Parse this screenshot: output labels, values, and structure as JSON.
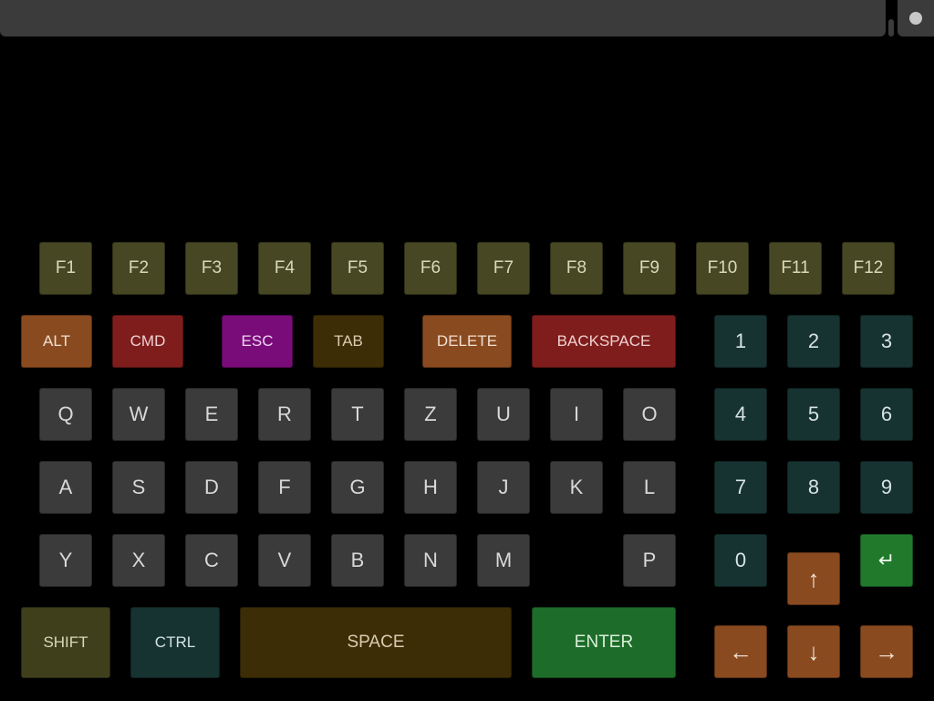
{
  "top_bar": {
    "input_value": "",
    "record_icon": "circle-dot"
  },
  "keyboard": {
    "function_row": [
      "F1",
      "F2",
      "F3",
      "F4",
      "F5",
      "F6",
      "F7",
      "F8",
      "F9",
      "F10",
      "F11",
      "F12"
    ],
    "modifier_row": {
      "alt": "ALT",
      "cmd": "CMD",
      "esc": "ESC",
      "tab": "TAB",
      "delete": "DELETE",
      "backspace": "BACKSPACE"
    },
    "letter_row_1": [
      "Q",
      "W",
      "E",
      "R",
      "T",
      "Z",
      "U",
      "I",
      "O"
    ],
    "letter_row_2": [
      "A",
      "S",
      "D",
      "F",
      "G",
      "H",
      "J",
      "K",
      "L"
    ],
    "letter_row_3": [
      "Y",
      "X",
      "C",
      "V",
      "B",
      "N",
      "M",
      "P"
    ],
    "bottom_row": {
      "shift": "SHIFT",
      "ctrl": "CTRL",
      "space": "SPACE",
      "enter": "ENTER"
    },
    "numpad": [
      "1",
      "2",
      "3",
      "4",
      "5",
      "6",
      "7",
      "8",
      "9",
      "0"
    ],
    "numpad_return": "↵",
    "arrows": {
      "up": "↑",
      "left": "←",
      "down": "↓",
      "right": "→"
    }
  },
  "colors": {
    "background": "#000000",
    "bar": "#3b3b3b",
    "function_key": "#474724",
    "letter_key": "#3b3b3b",
    "numpad_key": "#163331",
    "arrow_key": "#8a4a1f",
    "enter_key": "#1e6c2a",
    "esc_key": "#7a0c7a",
    "cmd_key": "#7f1d1d"
  }
}
